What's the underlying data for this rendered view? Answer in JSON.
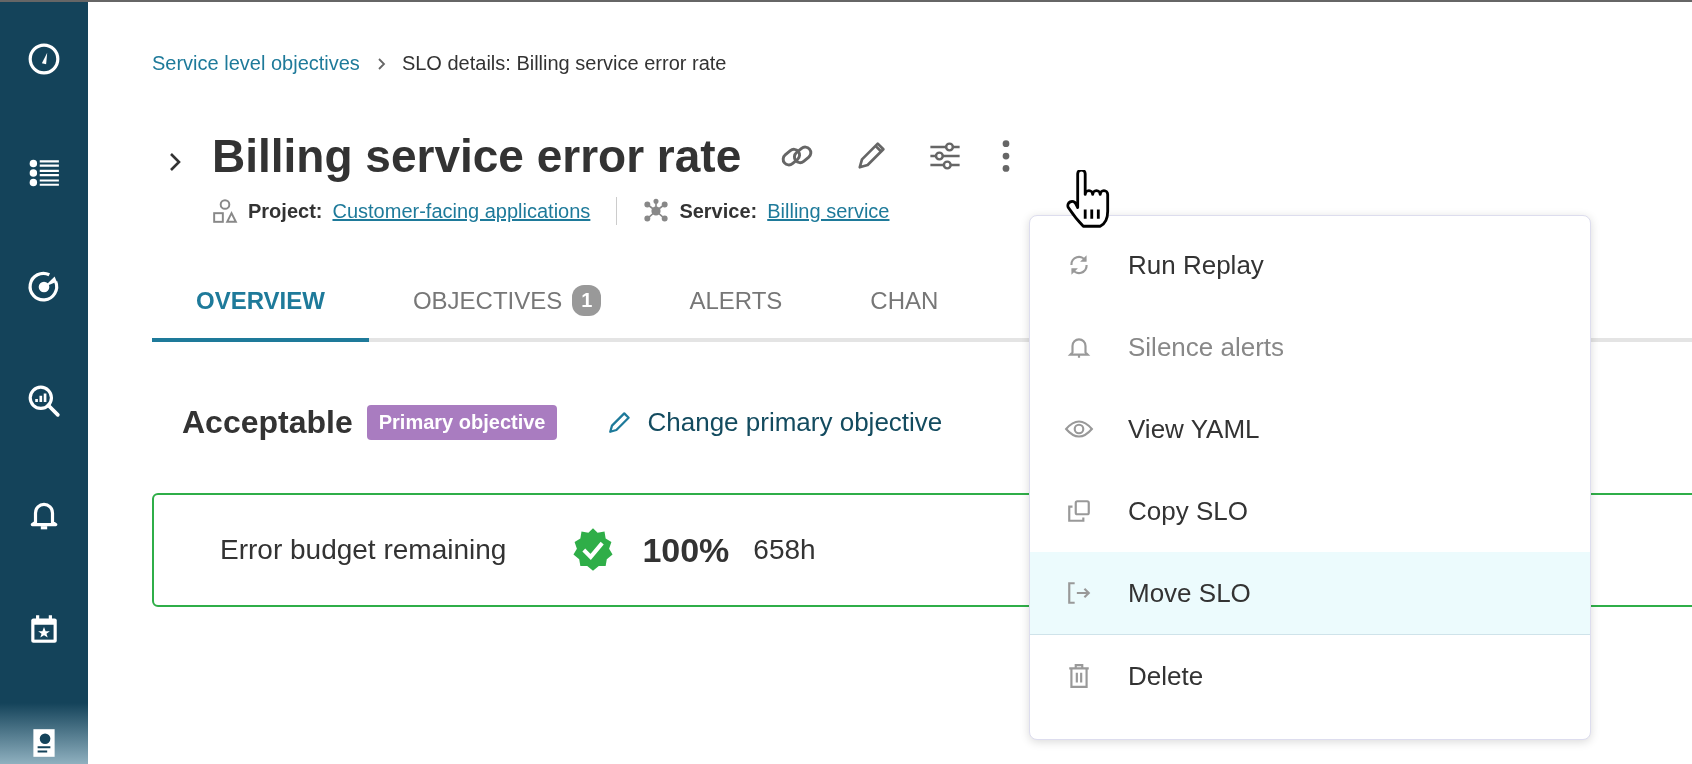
{
  "breadcrumb": {
    "link": "Service level objectives",
    "current": "SLO details: Billing service error rate"
  },
  "title": "Billing service error rate",
  "meta": [
    {
      "label": "Project:",
      "value": "Customer-facing applications"
    },
    {
      "label": "Service:",
      "value": "Billing service"
    }
  ],
  "tabs": [
    {
      "label": "OVERVIEW",
      "selected": true
    },
    {
      "label": "OBJECTIVES",
      "selected": false,
      "badge": "1"
    },
    {
      "label": "ALERTS",
      "selected": false
    },
    {
      "label": "CHAN",
      "selected": false
    }
  ],
  "objective": {
    "name": "Acceptable",
    "tag": "Primary objective",
    "change_link": "Change primary objective"
  },
  "budget": {
    "label": "Error budget remaining",
    "percent": "100%",
    "hours": "658h"
  },
  "menu": [
    {
      "label": "Run Replay",
      "selected": false,
      "disabled": false
    },
    {
      "label": "Silence alerts",
      "selected": false,
      "disabled": true
    },
    {
      "label": "View YAML",
      "selected": false,
      "disabled": false
    },
    {
      "label": "Copy SLO",
      "selected": false,
      "disabled": false
    },
    {
      "label": "Move SLO",
      "selected": true,
      "disabled": false
    },
    {
      "label": "Delete",
      "selected": false,
      "disabled": false
    }
  ]
}
